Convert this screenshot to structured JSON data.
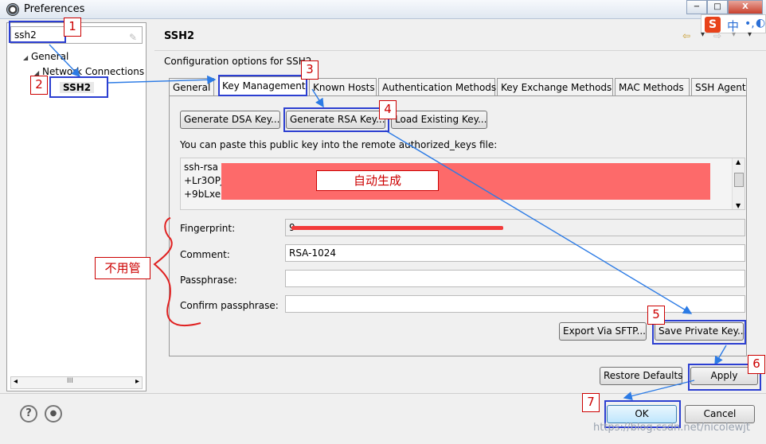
{
  "window": {
    "title": "Preferences",
    "controls": {
      "minimize": "−",
      "maximize": "□",
      "close": "X"
    }
  },
  "ime": {
    "logo": "S",
    "lang": "中",
    "punct": "•,",
    "width": "◐"
  },
  "sidebar": {
    "filter_value": "ssh2",
    "tree": [
      {
        "label": "General"
      },
      {
        "label": "Network Connections"
      },
      {
        "label": "SSH2"
      }
    ],
    "scroll_left": "◂",
    "scroll_thumb": "III",
    "scroll_right": "▸"
  },
  "page": {
    "title": "SSH2",
    "description": "Configuration options for SSH2",
    "nav": {
      "back": "⇦",
      "back_menu": "▾",
      "forward": "⇨",
      "forward_menu": "▾",
      "view_menu": "▾"
    }
  },
  "tabs": [
    {
      "label": "General"
    },
    {
      "label": "Key Management",
      "active": true
    },
    {
      "label": "Known Hosts"
    },
    {
      "label": "Authentication Methods"
    },
    {
      "label": "Key Exchange Methods"
    },
    {
      "label": "MAC Methods"
    },
    {
      "label": "SSH Agent"
    }
  ],
  "key_management": {
    "buttons": {
      "generate_dsa": "Generate DSA Key...",
      "generate_rsa": "Generate RSA Key...",
      "load_existing": "Load Existing Key..."
    },
    "paste_label": "You can paste this public key into the remote authorized_keys file:",
    "public_key_lines": [
      "ssh-rsa",
      "+Lr3OPJ",
      "+9bLxeE"
    ],
    "fields": {
      "fingerprint_label": "Fingerprint:",
      "fingerprint_value": "9",
      "comment_label": "Comment:",
      "comment_value": "RSA-1024",
      "passphrase_label": "Passphrase:",
      "passphrase_value": "",
      "confirm_label": "Confirm passphrase:",
      "confirm_value": ""
    },
    "export_button": "Export Via SFTP...",
    "save_private_button": "Save Private Key..."
  },
  "footer": {
    "restore_defaults": "Restore Defaults",
    "apply": "Apply",
    "ok": "OK",
    "cancel": "Cancel",
    "help_icon": "?",
    "settings_icon": "●"
  },
  "annotations": {
    "steps": [
      "1",
      "2",
      "3",
      "4",
      "5",
      "6",
      "7"
    ],
    "auto_generate": "自动生成",
    "ignore": "不用管",
    "color": "#2c3fd1",
    "label_color": "#cc0000"
  },
  "watermark": "https://blog.csdn.net/nicolewjt"
}
